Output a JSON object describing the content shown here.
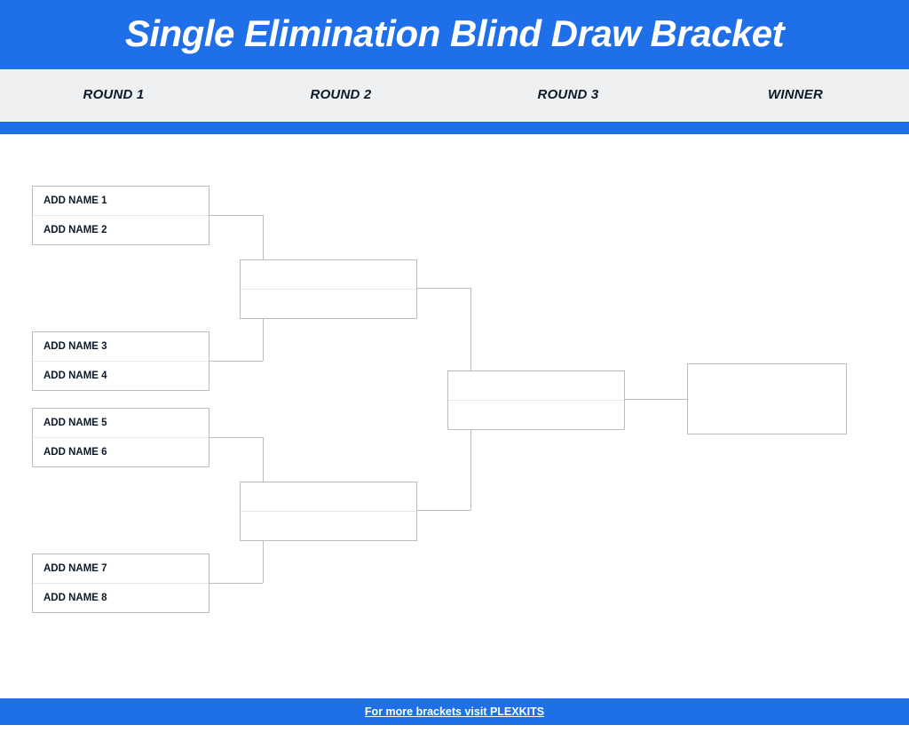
{
  "title": "Single Elimination Blind Draw Bracket",
  "rounds": {
    "r1": "ROUND 1",
    "r2": "ROUND 2",
    "r3": "ROUND 3",
    "winner": "WINNER"
  },
  "round1": {
    "match1": {
      "p1": "ADD NAME 1",
      "p2": "ADD NAME 2"
    },
    "match2": {
      "p1": "ADD NAME 3",
      "p2": "ADD NAME 4"
    },
    "match3": {
      "p1": "ADD NAME 5",
      "p2": "ADD NAME 6"
    },
    "match4": {
      "p1": "ADD NAME 7",
      "p2": "ADD NAME 8"
    }
  },
  "round2": {
    "match1": {
      "p1": "",
      "p2": ""
    },
    "match2": {
      "p1": "",
      "p2": ""
    }
  },
  "round3": {
    "match1": {
      "p1": "",
      "p2": ""
    }
  },
  "winner_box": {
    "p1": ""
  },
  "footer": "For more brackets visit PLEXKITS"
}
